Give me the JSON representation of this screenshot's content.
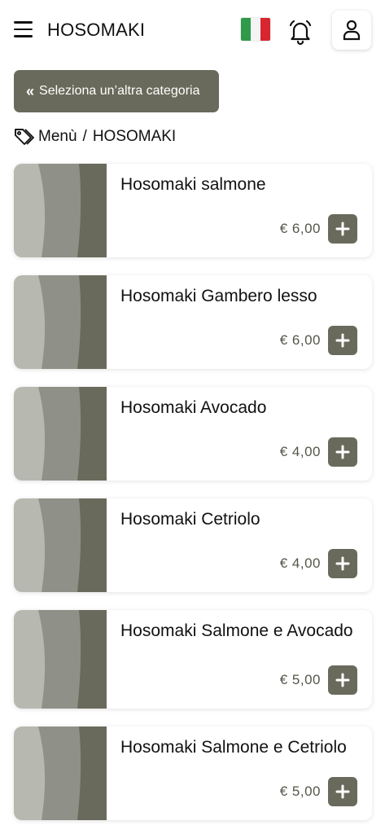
{
  "header": {
    "title": "HOSOMAKI",
    "menu_icon": "hamburger-menu-icon",
    "language_icon": "italy-flag-icon",
    "notifications_icon": "bell-icon",
    "profile_icon": "user-icon"
  },
  "navigation": {
    "category_button": "Seleziona un’altra categoria",
    "category_button_icon": "double-chevron-left-icon"
  },
  "breadcrumb": {
    "icon": "tag-icon",
    "root": "Menù",
    "separator": "/",
    "current": "HOSOMAKI"
  },
  "products": [
    {
      "name": "Hosomaki salmone",
      "price": "€ 6,00"
    },
    {
      "name": "Hosomaki Gambero lesso",
      "price": "€ 6,00"
    },
    {
      "name": "Hosomaki Avocado",
      "price": "€ 4,00"
    },
    {
      "name": "Hosomaki Cetriolo",
      "price": "€ 4,00"
    },
    {
      "name": "Hosomaki Salmone e Avocado",
      "price": "€ 5,00"
    },
    {
      "name": "Hosomaki Salmone e Cetriolo",
      "price": "€ 5,00"
    }
  ],
  "add_button_icon": "plus-icon",
  "colors": {
    "primary": "#6a6a5c",
    "price_text": "#55554b",
    "placeholder_light": "#b7b8b0",
    "placeholder_mid": "#8f9087",
    "placeholder_dark": "#6a6a5c"
  }
}
